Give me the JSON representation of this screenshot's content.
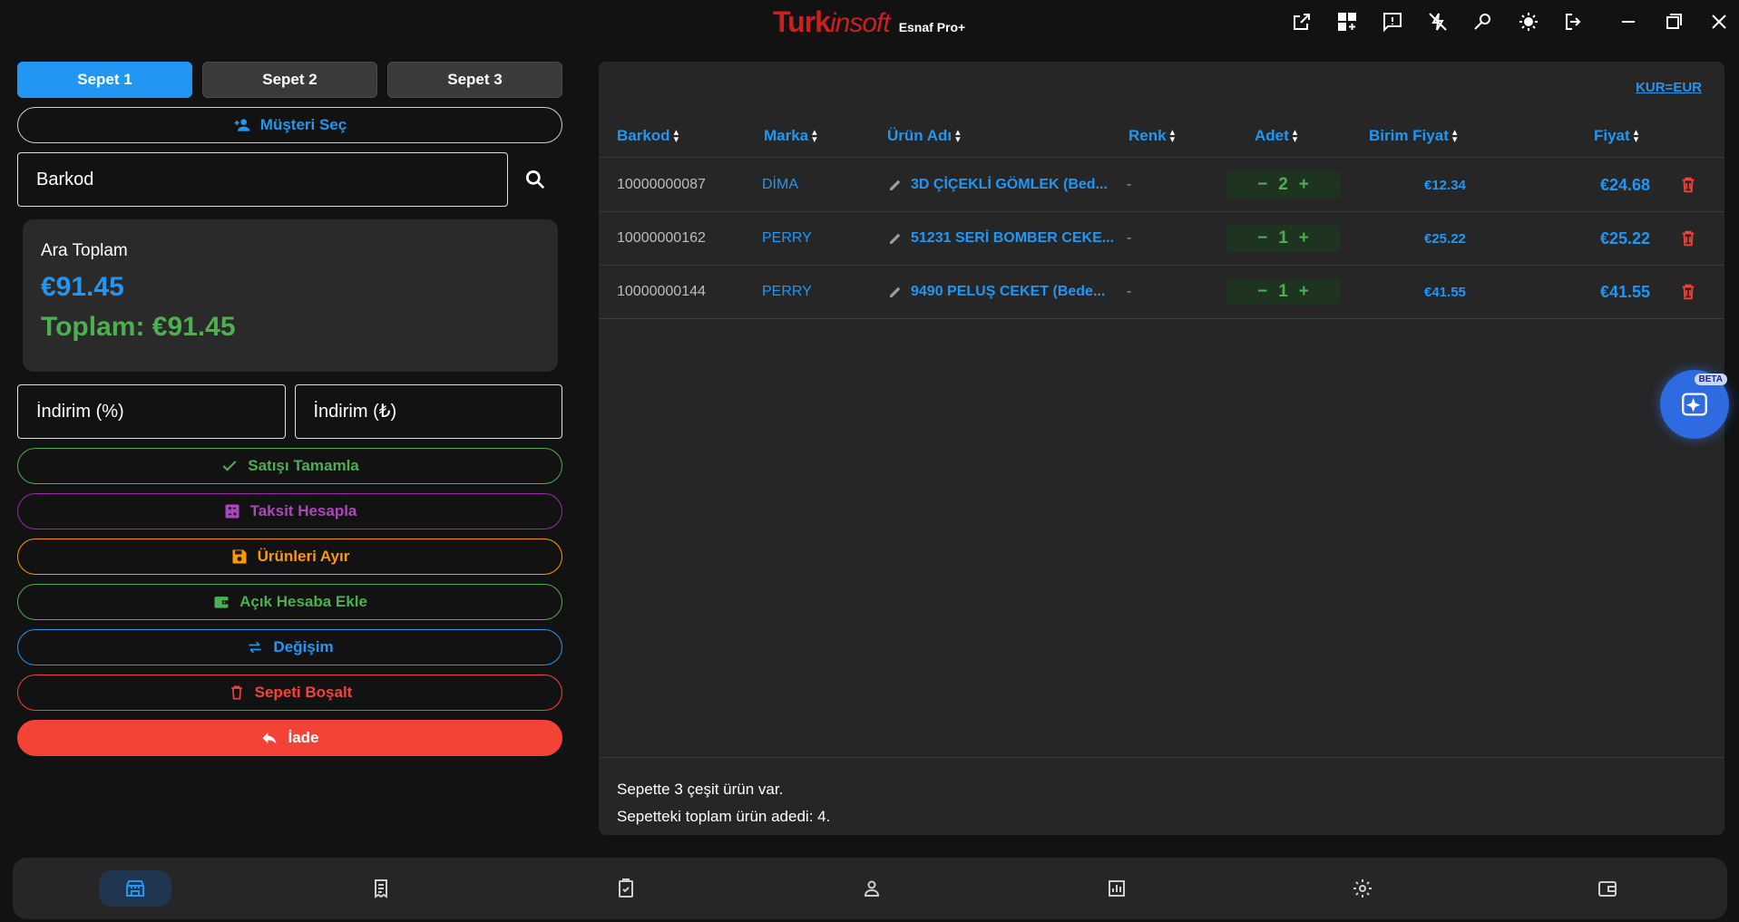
{
  "app": {
    "brand_turk": "Turk",
    "brand_insoft": "insoft",
    "edition": "Esnaf Pro+"
  },
  "titlebar_icons": [
    "open-external-icon",
    "add-widget-icon",
    "feedback-icon",
    "flash-off-icon",
    "search-person-icon",
    "brightness-icon",
    "logout-icon"
  ],
  "window_controls": [
    "minimize-icon",
    "maximize-icon",
    "close-icon"
  ],
  "tabs": [
    {
      "label": "Sepet 1",
      "active": true
    },
    {
      "label": "Sepet 2",
      "active": false
    },
    {
      "label": "Sepet 3",
      "active": false
    }
  ],
  "customer_button": "Müşteri Seç",
  "barcode": {
    "placeholder": "Barkod",
    "value": ""
  },
  "summary": {
    "subtotal_label": "Ara Toplam",
    "subtotal": "€91.45",
    "total": "Toplam: €91.45"
  },
  "discount": {
    "percent_placeholder": "İndirim (%)",
    "amount_placeholder": "İndirim (₺)"
  },
  "actions": {
    "complete": "Satışı Tamamla",
    "installment": "Taksit Hesapla",
    "reserve": "Ürünleri Ayır",
    "open_account": "Açık Hesaba Ekle",
    "exchange": "Değişim",
    "clear": "Sepeti Boşalt",
    "refund": "İade"
  },
  "currency_link": "KUR=EUR",
  "table": {
    "headers": {
      "barkod": "Barkod",
      "marka": "Marka",
      "urun": "Ürün Adı",
      "renk": "Renk",
      "adet": "Adet",
      "birim": "Birim Fiyat",
      "fiyat": "Fiyat"
    },
    "rows": [
      {
        "barkod": "10000000087",
        "marka": "DİMA",
        "urun": "3D ÇİÇEKLİ GÖMLEK (Bed...",
        "renk": "-",
        "adet": "2",
        "birim": "€12.34",
        "fiyat": "€24.68"
      },
      {
        "barkod": "10000000162",
        "marka": "PERRY",
        "urun": "51231 SERİ BOMBER CEKE...",
        "renk": "-",
        "adet": "1",
        "birim": "€25.22",
        "fiyat": "€25.22"
      },
      {
        "barkod": "10000000144",
        "marka": "PERRY",
        "urun": "9490 PELUŞ CEKET (Bede...",
        "renk": "-",
        "adet": "1",
        "birim": "€41.55",
        "fiyat": "€41.55"
      }
    ]
  },
  "footer": {
    "line1": "Sepette 3 çeşit ürün var.",
    "line2": "Sepetteki toplam ürün adedi: 4."
  },
  "ai_button": {
    "badge": "BETA"
  },
  "bottom_nav": [
    {
      "icon": "store-icon",
      "active": true
    },
    {
      "icon": "receipt-icon",
      "active": false
    },
    {
      "icon": "clipboard-check-icon",
      "active": false
    },
    {
      "icon": "person-icon",
      "active": false
    },
    {
      "icon": "bar-chart-icon",
      "active": false
    },
    {
      "icon": "settings-icon",
      "active": false
    },
    {
      "icon": "wallet-icon",
      "active": false
    }
  ]
}
